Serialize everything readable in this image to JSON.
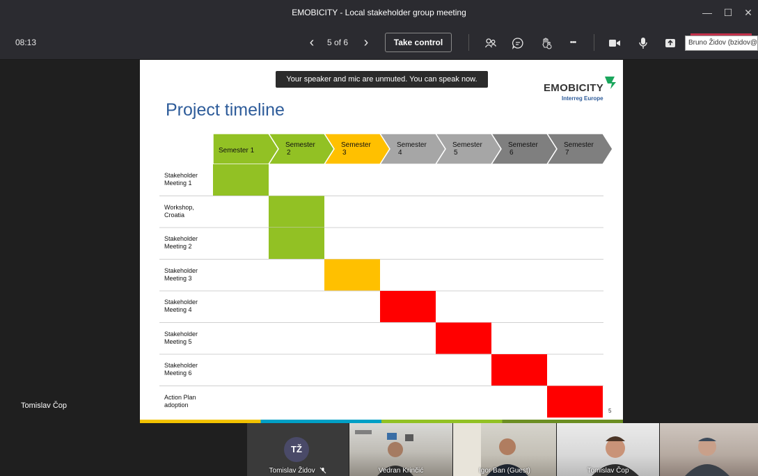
{
  "window": {
    "title": "EMOBICITY - Local stakeholder group meeting",
    "minimize_glyph": "—",
    "maximize_glyph": "☐",
    "close_glyph": "✕"
  },
  "toolbar": {
    "time": "08:13",
    "prev_glyph": "‹",
    "page_indicator": "5 of 6",
    "next_glyph": "›",
    "take_control": "Take control",
    "participants_icon": "people-icon",
    "chat_icon": "chat-icon",
    "reactions_icon": "raise-hand-icon",
    "more_glyph": "•••",
    "camera_icon": "camera-icon",
    "mic_icon": "microphone-icon",
    "share_icon": "share-tray-icon",
    "user_tooltip": "Bruno Židov (bzidov@e"
  },
  "slide": {
    "banner": "Your speaker and mic are unmuted. You can speak now.",
    "title": "Project timeline",
    "logo_text": "EMOBICITY",
    "logo_sub": "Interreg Europe",
    "page_number": "5",
    "semesters": [
      {
        "line1": "Semester 1",
        "line2": "",
        "color": "#92c124"
      },
      {
        "line1": "Semester",
        "line2": "2",
        "color": "#92c124"
      },
      {
        "line1": "Semester",
        "line2": "3",
        "color": "#ffc000"
      },
      {
        "line1": "Semester",
        "line2": "4",
        "color": "#a6a6a6"
      },
      {
        "line1": "Semester",
        "line2": "5",
        "color": "#a6a6a6"
      },
      {
        "line1": "Semester",
        "line2": "6",
        "color": "#7f7f7f"
      },
      {
        "line1": "Semester",
        "line2": "7",
        "color": "#7f7f7f"
      }
    ],
    "rows": [
      {
        "line1": "Stakeholder",
        "line2": "Meeting 1",
        "semester": 1,
        "color": "#92c124"
      },
      {
        "line1": "Workshop,",
        "line2": "Croatia",
        "semester": 2,
        "color": "#92c124"
      },
      {
        "line1": "Stakeholder",
        "line2": "Meeting 2",
        "semester": 2,
        "color": "#92c124"
      },
      {
        "line1": "Stakeholder",
        "line2": "Meeting 3",
        "semester": 3,
        "color": "#ffc000"
      },
      {
        "line1": "Stakeholder",
        "line2": "Meeting 4",
        "semester": 4,
        "color": "#ff0000"
      },
      {
        "line1": "Stakeholder",
        "line2": "Meeting 5",
        "semester": 5,
        "color": "#ff0000"
      },
      {
        "line1": "Stakeholder",
        "line2": "Meeting 6",
        "semester": 6,
        "color": "#ff0000"
      },
      {
        "line1": "Action Plan",
        "line2": "adoption",
        "semester": 7,
        "color": "#ff0000"
      }
    ],
    "strip_colors": [
      "#f2c200",
      "#00a0c6",
      "#92c124",
      "#6b8e23"
    ]
  },
  "presenter_label": "Tomislav Čop",
  "participants": [
    {
      "name": "Tomislav Židov",
      "initials": "TŽ",
      "muted_icon": "mic-off-icon"
    },
    {
      "name": "Vedran Krinčić"
    },
    {
      "name": "Igor Ban (Guest)"
    },
    {
      "name": "Tomislav Čop"
    },
    {
      "name": ""
    }
  ]
}
